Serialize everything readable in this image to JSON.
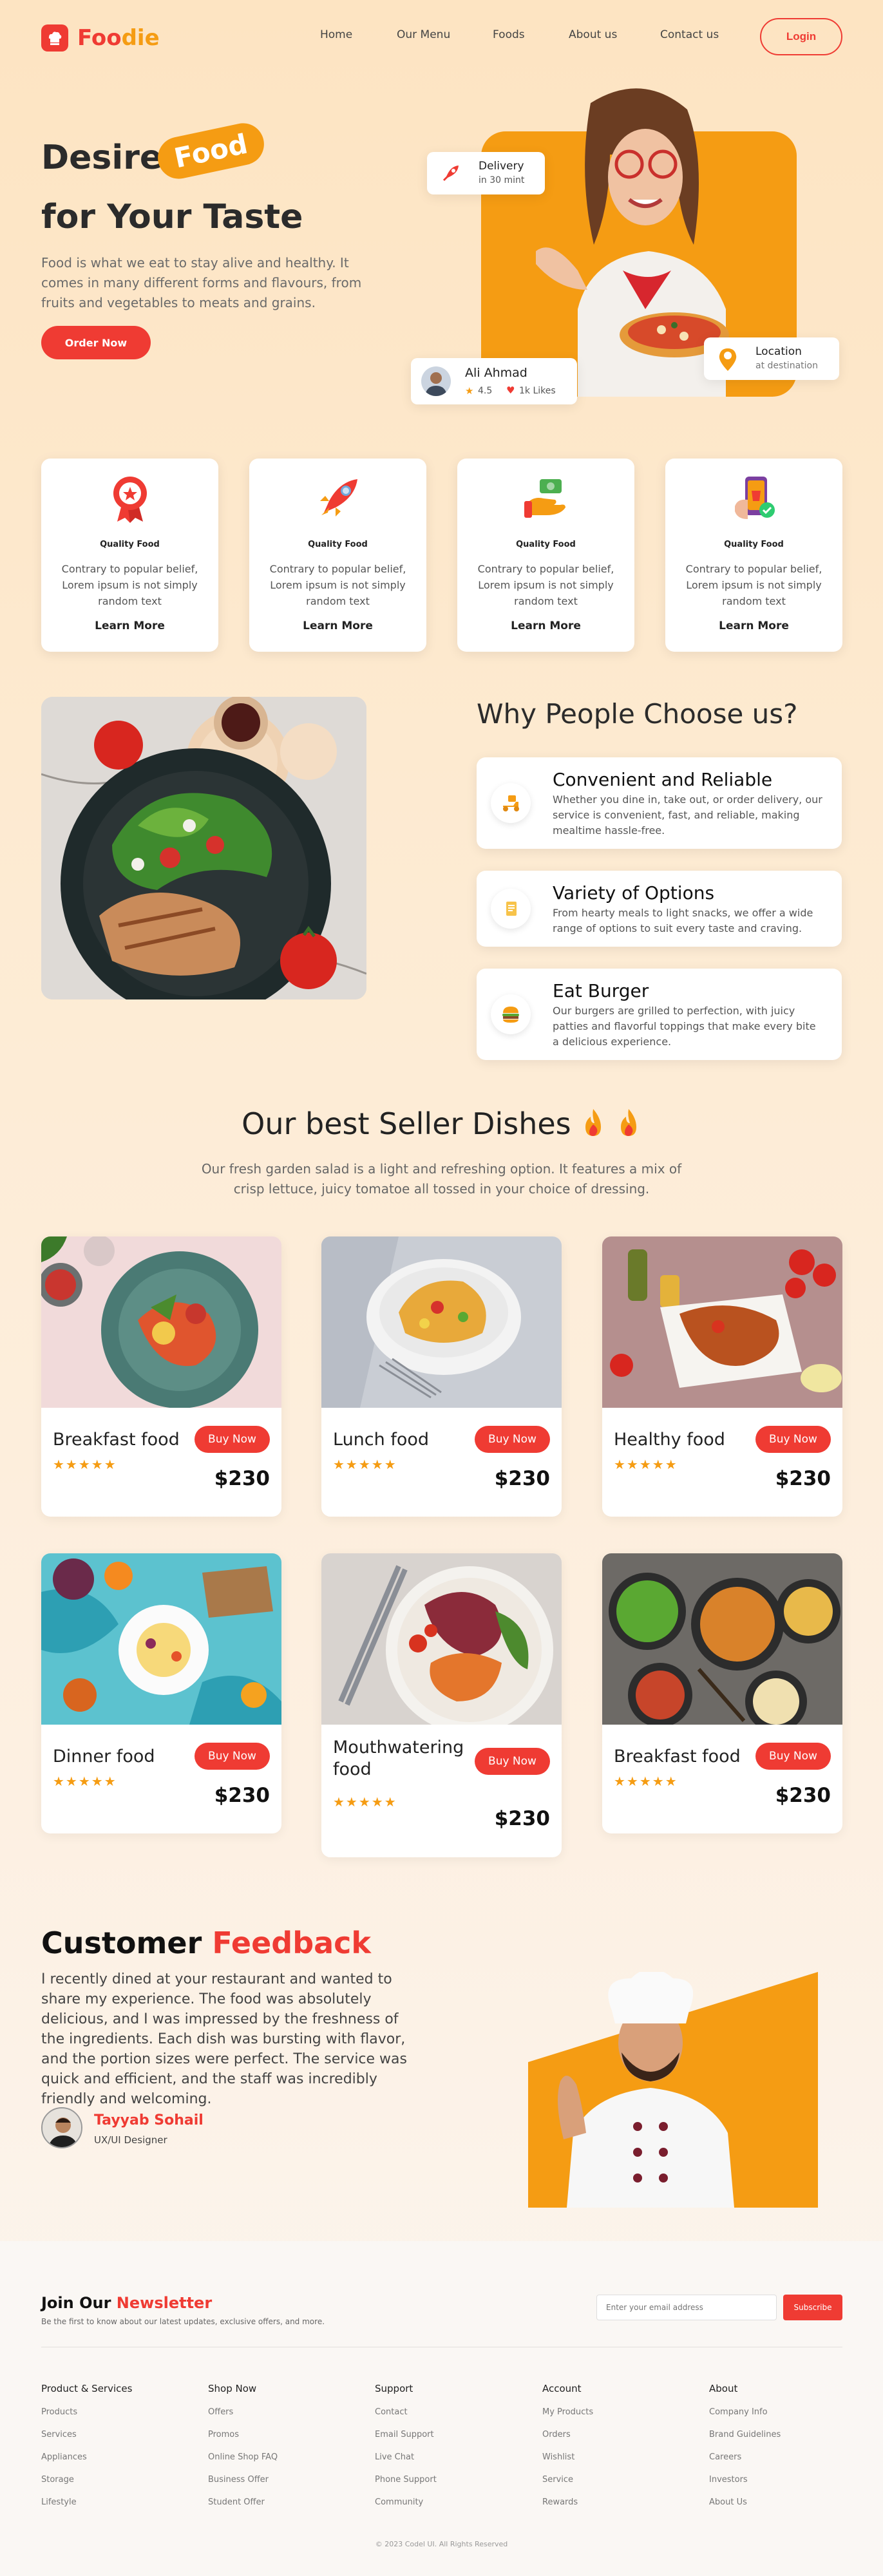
{
  "brand": {
    "name_a": "Foo",
    "name_b": "die",
    "accent": "#ef3b33",
    "orange": "#f59c13"
  },
  "nav": {
    "items": [
      "Home",
      "Our Menu",
      "Foods",
      "About us",
      "Contact us"
    ],
    "login": "Login"
  },
  "hero": {
    "title_1": "Desire",
    "pill": "Food",
    "title_2": "for Your Taste",
    "text": "Food is what we eat to stay alive and healthy. It comes in many different forms and flavours, from fruits and vegetables to meats and grains.",
    "cta": "Order Now",
    "delivery": {
      "title": "Delivery",
      "sub": "in 30 mint"
    },
    "location": {
      "title": "Location",
      "sub": "at destination"
    },
    "reviewer": {
      "name": "Ali Ahmad",
      "rating": "4.5",
      "likes": "1k Likes"
    }
  },
  "services": [
    {
      "icon": "award-icon",
      "title": "Quality Food",
      "text": "Contrary to popular belief, Lorem ipsum is not simply random text",
      "link": "Learn More"
    },
    {
      "icon": "rocket-icon",
      "title": "Quality Food",
      "text": "Contrary to popular belief, Lorem ipsum is not simply random text",
      "link": "Learn More"
    },
    {
      "icon": "payment-icon",
      "title": "Quality Food",
      "text": "Contrary to popular belief, Lorem ipsum is not simply random text",
      "link": "Learn More"
    },
    {
      "icon": "phone-order-icon",
      "title": "Quality Food",
      "text": "Contrary to popular belief, Lorem ipsum is not simply random text",
      "link": "Learn More"
    }
  ],
  "why": {
    "title": "Why People Choose us?",
    "items": [
      {
        "icon": "delivery-scooter-icon",
        "title": "Convenient and Reliable",
        "text": "Whether you dine in, take out, or order delivery, our service is convenient, fast, and reliable, making mealtime hassle-free."
      },
      {
        "icon": "menu-list-icon",
        "title": "Variety of Options",
        "text": "From hearty meals to light snacks, we offer a wide range of options to suit every taste and craving."
      },
      {
        "icon": "burger-icon",
        "title": "Eat Burger",
        "text": "Our burgers are grilled to perfection, with juicy patties and flavorful toppings that make every bite a delicious experience."
      }
    ]
  },
  "dishes": {
    "title": "Our best Seller Dishes",
    "subtitle": "Our fresh garden salad is a light and refreshing option. It features a mix of crisp lettuce, juicy tomatoe all tossed in your choice of dressing.",
    "buy": "Buy Now",
    "stars": "★★★★★",
    "items": [
      {
        "name": "Breakfast food",
        "price": "$230"
      },
      {
        "name": "Lunch food",
        "price": "$230"
      },
      {
        "name": "Healthy food",
        "price": "$230"
      },
      {
        "name": "Dinner food",
        "price": "$230"
      },
      {
        "name": "Mouthwatering food",
        "price": "$230"
      },
      {
        "name": "Breakfast food",
        "price": "$230"
      }
    ]
  },
  "feedback": {
    "title_a": "Customer",
    "title_b": "Feedback",
    "text": "I recently dined at your restaurant and wanted to share my experience. The food was absolutely delicious, and I was impressed by the freshness of the ingredients. Each dish was bursting with flavor, and the portion sizes were perfect. The service was quick and efficient, and the staff was incredibly friendly and welcoming.",
    "name": "Tayyab Sohail",
    "role": "UX/UI Designer"
  },
  "newsletter": {
    "title_a": "Join Our",
    "title_b": "Newsletter",
    "sub": "Be the first to know about our latest updates, exclusive offers, and more.",
    "placeholder": "Enter your email address",
    "button": "Subscribe"
  },
  "footer": {
    "columns": [
      {
        "title": "Product & Services",
        "links": [
          "Products",
          "Services",
          "Appliances",
          "Storage",
          "Lifestyle"
        ]
      },
      {
        "title": "Shop Now",
        "links": [
          "Offers",
          "Promos",
          "Online Shop FAQ",
          "Business Offer",
          "Student Offer"
        ]
      },
      {
        "title": "Support",
        "links": [
          "Contact",
          "Email Support",
          "Live Chat",
          "Phone Support",
          "Community"
        ]
      },
      {
        "title": "Account",
        "links": [
          "My Products",
          "Orders",
          "Wishlist",
          "Service",
          "Rewards"
        ]
      },
      {
        "title": "About",
        "links": [
          "Company Info",
          "Brand Guidelines",
          "Careers",
          "Investors",
          "About Us"
        ]
      }
    ],
    "copyright": "© 2023 Codel UI. All Rights Reserved"
  }
}
